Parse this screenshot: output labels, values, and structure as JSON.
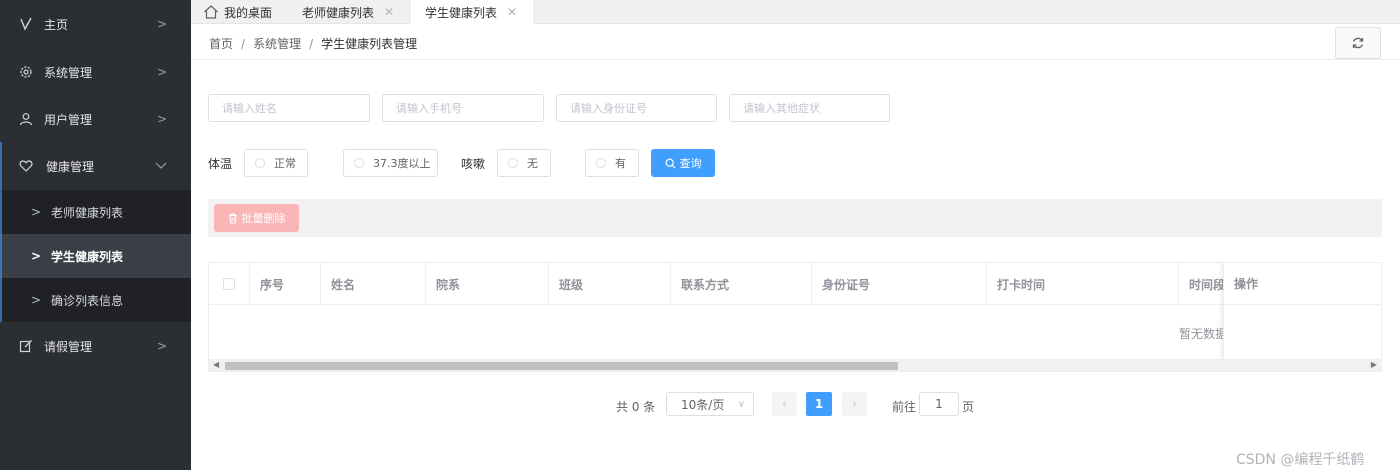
{
  "sidebar": {
    "items": [
      {
        "label": "主页",
        "icon": "leaf-icon"
      },
      {
        "label": "系统管理",
        "icon": "gear-icon"
      },
      {
        "label": "用户管理",
        "icon": "user-icon"
      },
      {
        "label": "健康管理",
        "icon": "heart-icon"
      },
      {
        "label": "请假管理",
        "icon": "edit-icon"
      }
    ],
    "health_children": [
      {
        "label": "老师健康列表"
      },
      {
        "label": "学生健康列表",
        "active": true
      },
      {
        "label": "确诊列表信息"
      }
    ]
  },
  "tabs": [
    {
      "label": "我的桌面",
      "icon": "home-icon"
    },
    {
      "label": "老师健康列表",
      "closable": true
    },
    {
      "label": "学生健康列表",
      "closable": true,
      "active": true
    }
  ],
  "breadcrumb": [
    "首页",
    "系统管理",
    "学生健康列表管理"
  ],
  "filters": {
    "name_placeholder": "请输入姓名",
    "phone_placeholder": "请输入手机号",
    "idcard_placeholder": "请输入身份证号",
    "symptom_placeholder": "请输入其他症状",
    "temp_label": "体温",
    "temp_options": [
      "正常",
      "37.3度以上"
    ],
    "cough_label": "咳嗽",
    "cough_options": [
      "无",
      "有"
    ],
    "search_label": "查询"
  },
  "toolbar": {
    "batch_delete_label": "批量删除"
  },
  "table": {
    "columns": [
      "序号",
      "姓名",
      "院系",
      "班级",
      "联系方式",
      "身份证号",
      "打卡时间",
      "时间段"
    ],
    "action_column": "操作",
    "empty_text": "暂无数据"
  },
  "pagination": {
    "total_text": "共 0 条",
    "page_size": "10条/页",
    "current_page": "1",
    "goto_label": "前往",
    "goto_value": "1",
    "page_suffix": "页"
  },
  "watermark": "CSDN @编程千纸鹤",
  "colors": {
    "sidebar_bg": "#2b2e33",
    "accent": "#409eff",
    "danger_light": "#fab6b6"
  }
}
